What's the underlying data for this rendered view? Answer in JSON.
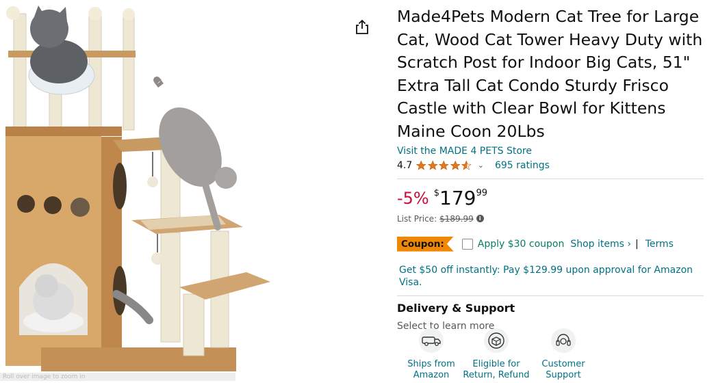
{
  "product": {
    "title": "Made4Pets Modern Cat Tree for Large Cat, Wood Cat Tower Heavy Duty with Scratch Post for Indoor Big Cats, 51\" Extra Tall Cat Condo Sturdy Frisco Castle with Clear Bowl for Kittens Maine Coon 20Lbs",
    "store_link": "Visit the MADE 4 PETS Store",
    "rating": "4.7",
    "ratings_count": "695 ratings",
    "image_caption": "Roll over image to zoom in"
  },
  "price": {
    "discount": "-5%",
    "symbol": "$",
    "whole": "179",
    "fraction": "99",
    "list_label": "List Price:",
    "list_value": "$189.99"
  },
  "coupon": {
    "badge": "Coupon:",
    "text": "Apply $30 coupon",
    "shop_items": "Shop items ›",
    "separator": "|",
    "terms": "Terms"
  },
  "offer": {
    "visa": "Get $50 off instantly: Pay $129.99 upon approval for Amazon Visa."
  },
  "delivery": {
    "title": "Delivery & Support",
    "subtitle": "Select to learn more",
    "items": [
      {
        "label": "Ships from Amazon",
        "icon": "truck-icon"
      },
      {
        "label": "Eligible for Return, Refund",
        "icon": "return-box-icon"
      },
      {
        "label": "Customer Support",
        "icon": "headset-icon"
      }
    ]
  },
  "colors": {
    "link": "#007185",
    "discount": "#cc0c39",
    "star": "#de7921",
    "coupon_badge": "#f08804",
    "coupon_text": "#067d62"
  }
}
